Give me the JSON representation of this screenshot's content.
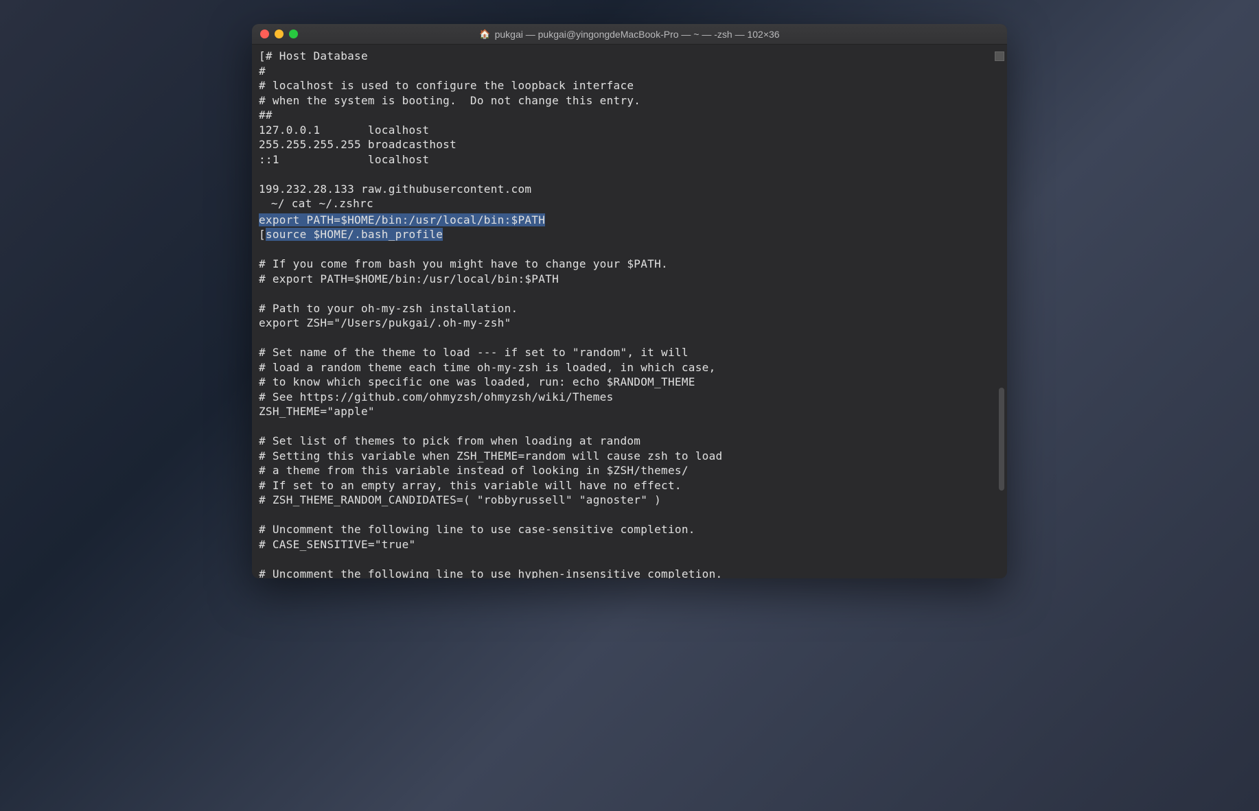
{
  "window": {
    "title": "pukgai — pukgai@yingongdeMacBook-Pro — ~ — -zsh — 102×36"
  },
  "terminal": {
    "lines": [
      {
        "text": "[# Host Database",
        "type": "plain"
      },
      {
        "text": "#",
        "type": "plain"
      },
      {
        "text": "# localhost is used to configure the loopback interface",
        "type": "plain"
      },
      {
        "text": "# when the system is booting.  Do not change this entry.",
        "type": "plain"
      },
      {
        "text": "##",
        "type": "plain"
      },
      {
        "text": "127.0.0.1       localhost",
        "type": "plain"
      },
      {
        "text": "255.255.255.255 broadcasthost",
        "type": "plain"
      },
      {
        "text": "::1             localhost",
        "type": "plain"
      },
      {
        "text": "",
        "type": "plain"
      },
      {
        "text": "199.232.28.133 raw.githubusercontent.com",
        "type": "plain"
      },
      {
        "text": " ~/ cat ~/.zshrc",
        "type": "prompt"
      },
      {
        "text": "export PATH=$HOME/bin:/usr/local/bin:$PATH",
        "type": "highlighted"
      },
      {
        "text": "source $HOME/.bash_profile",
        "type": "highlighted-bracket"
      },
      {
        "text": "",
        "type": "plain"
      },
      {
        "text": "# If you come from bash you might have to change your $PATH.",
        "type": "plain"
      },
      {
        "text": "# export PATH=$HOME/bin:/usr/local/bin:$PATH",
        "type": "plain"
      },
      {
        "text": "",
        "type": "plain"
      },
      {
        "text": "# Path to your oh-my-zsh installation.",
        "type": "plain"
      },
      {
        "text": "export ZSH=\"/Users/pukgai/.oh-my-zsh\"",
        "type": "plain"
      },
      {
        "text": "",
        "type": "plain"
      },
      {
        "text": "# Set name of the theme to load --- if set to \"random\", it will",
        "type": "plain"
      },
      {
        "text": "# load a random theme each time oh-my-zsh is loaded, in which case,",
        "type": "plain"
      },
      {
        "text": "# to know which specific one was loaded, run: echo $RANDOM_THEME",
        "type": "plain"
      },
      {
        "text": "# See https://github.com/ohmyzsh/ohmyzsh/wiki/Themes",
        "type": "plain"
      },
      {
        "text": "ZSH_THEME=\"apple\"",
        "type": "plain"
      },
      {
        "text": "",
        "type": "plain"
      },
      {
        "text": "# Set list of themes to pick from when loading at random",
        "type": "plain"
      },
      {
        "text": "# Setting this variable when ZSH_THEME=random will cause zsh to load",
        "type": "plain"
      },
      {
        "text": "# a theme from this variable instead of looking in $ZSH/themes/",
        "type": "plain"
      },
      {
        "text": "# If set to an empty array, this variable will have no effect.",
        "type": "plain"
      },
      {
        "text": "# ZSH_THEME_RANDOM_CANDIDATES=( \"robbyrussell\" \"agnoster\" )",
        "type": "plain"
      },
      {
        "text": "",
        "type": "plain"
      },
      {
        "text": "# Uncomment the following line to use case-sensitive completion.",
        "type": "plain"
      },
      {
        "text": "# CASE_SENSITIVE=\"true\"",
        "type": "plain"
      },
      {
        "text": "",
        "type": "plain"
      },
      {
        "text": "# Uncomment the following line to use hyphen-insensitive completion.",
        "type": "plain"
      }
    ]
  }
}
